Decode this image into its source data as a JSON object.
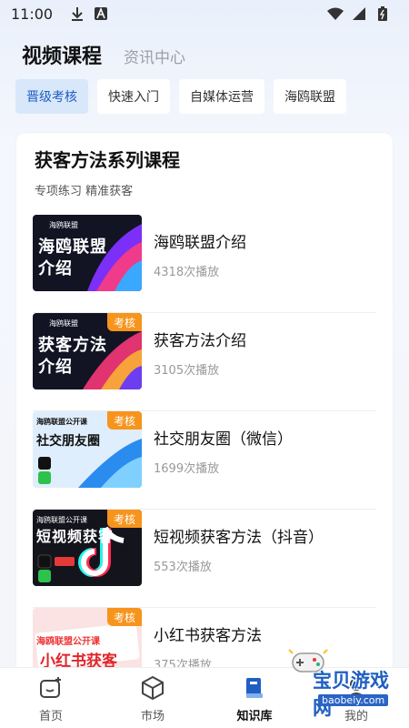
{
  "status": {
    "time": "11:00"
  },
  "top_tabs": {
    "active": "视频课程",
    "other": "资讯中心"
  },
  "chips": [
    "晋级考核",
    "快速入门",
    "自媒体运营",
    "海鸥联盟"
  ],
  "card": {
    "title": "获客方法系列课程",
    "subtitle": "专项练习 精准获客",
    "courses": [
      {
        "title": "海鸥联盟介绍",
        "plays": "4318次播放",
        "thumb_brand": "海鸥联盟",
        "thumb_lines": [
          "海鸥联盟",
          "介绍"
        ],
        "badge": ""
      },
      {
        "title": "获客方法介绍",
        "plays": "3105次播放",
        "thumb_brand": "海鸥联盟",
        "thumb_lines": [
          "获客方法",
          "介绍"
        ],
        "badge": "考核"
      },
      {
        "title": "社交朋友圈（微信）",
        "plays": "1699次播放",
        "thumb_brand": "海鸥联盟公开课",
        "thumb_lines": [
          "社交朋友圈"
        ],
        "badge": "考核"
      },
      {
        "title": "短视频获客方法（抖音）",
        "plays": "553次播放",
        "thumb_brand": "海鸥联盟公开课",
        "thumb_lines": [
          "短视频获客"
        ],
        "badge": "考核"
      },
      {
        "title": "小红书获客方法",
        "plays": "375次播放",
        "thumb_brand": "海鸥联盟公开课",
        "thumb_lines": [
          "小红书获客"
        ],
        "badge": "考核"
      }
    ]
  },
  "nav": {
    "items": [
      "首页",
      "市场",
      "知识库",
      "我的"
    ],
    "active_index": 2
  },
  "watermark": {
    "title": "宝贝游戏网",
    "url": "baobeiy.com"
  },
  "colors": {
    "accent": "#1f5fc2",
    "badge": "#f7941d",
    "chip_active_bg": "#d9e7fb"
  }
}
